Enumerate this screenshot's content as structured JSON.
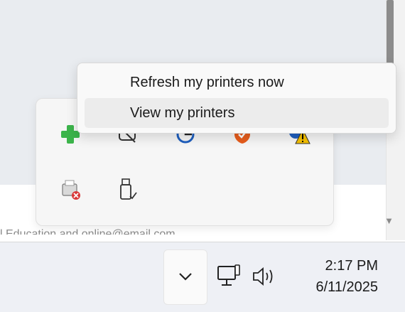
{
  "background": {
    "partial_text": "l Education and online@email.com"
  },
  "context_menu": {
    "items": [
      {
        "label": "Refresh my printers now"
      },
      {
        "label": "View my printers"
      }
    ]
  },
  "tray_icons": [
    {
      "name": "green-cross-icon"
    },
    {
      "name": "camera-off-icon"
    },
    {
      "name": "globe-sync-icon"
    },
    {
      "name": "shield-icon"
    },
    {
      "name": "warning-icon"
    },
    {
      "name": "printer-error-icon"
    },
    {
      "name": "usb-safely-remove-icon"
    }
  ],
  "taskbar": {
    "time": "2:17 PM",
    "date": "6/11/2025"
  },
  "colors": {
    "accent_green": "#3cb44b",
    "shield_orange": "#e85d1c",
    "warning_yellow": "#f5c000",
    "globe_blue": "#1f5fbf"
  }
}
